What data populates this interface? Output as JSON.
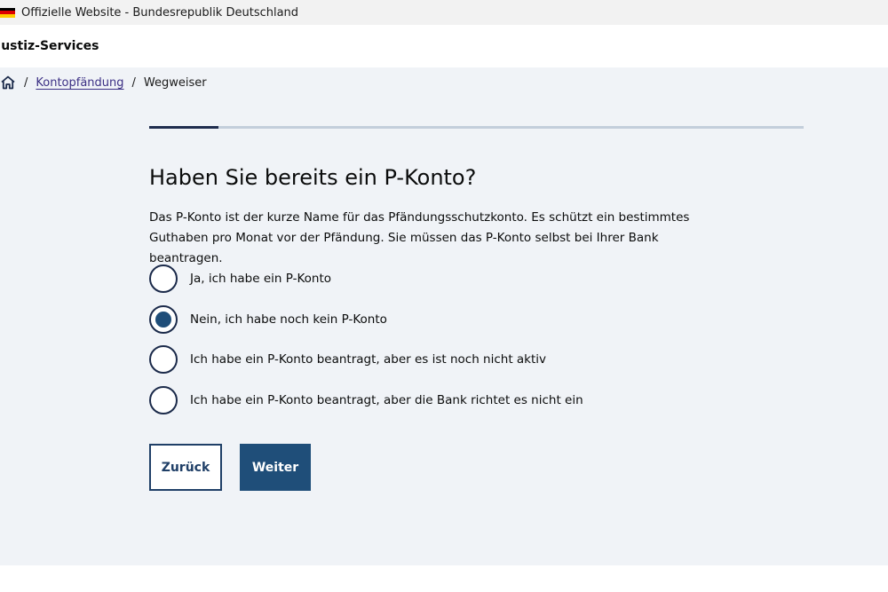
{
  "gov_bar": {
    "text": "Offizielle Website - Bundesrepublik Deutschland",
    "flag_colors": [
      "#000000",
      "#dd0000",
      "#ffcc00"
    ]
  },
  "header": {
    "title": "Justiz-Services"
  },
  "breadcrumb": {
    "home_icon": "home-icon",
    "separator": "/",
    "items": [
      {
        "label": "Kontopfändung"
      },
      {
        "label": "Wegweiser"
      }
    ]
  },
  "progress": {
    "value": 0.106
  },
  "question": {
    "title": "Haben Sie bereits ein P-Konto?",
    "description": "Das P-Konto ist der kurze Name für das Pfändungsschutzkonto. Es schützt ein bestimmtes Guthaben pro Monat vor der Pfändung. Sie müssen das P-Konto selbst bei Ihrer Bank beantragen."
  },
  "options": [
    {
      "label": "Ja, ich habe ein P-Konto",
      "selected": false
    },
    {
      "label": "Nein, ich habe noch kein P-Konto",
      "selected": true
    },
    {
      "label": "Ich habe ein P-Konto beantragt, aber es ist noch nicht aktiv",
      "selected": false
    },
    {
      "label": "Ich habe ein P-Konto beantragt, aber die Bank richtet es nicht ein",
      "selected": false
    }
  ],
  "buttons": {
    "back_label": "Zurück",
    "next_label": "Weiter"
  },
  "colors": {
    "primary": "#1f4e79",
    "background": "#f0f3f7",
    "link": "#3b2f84"
  }
}
